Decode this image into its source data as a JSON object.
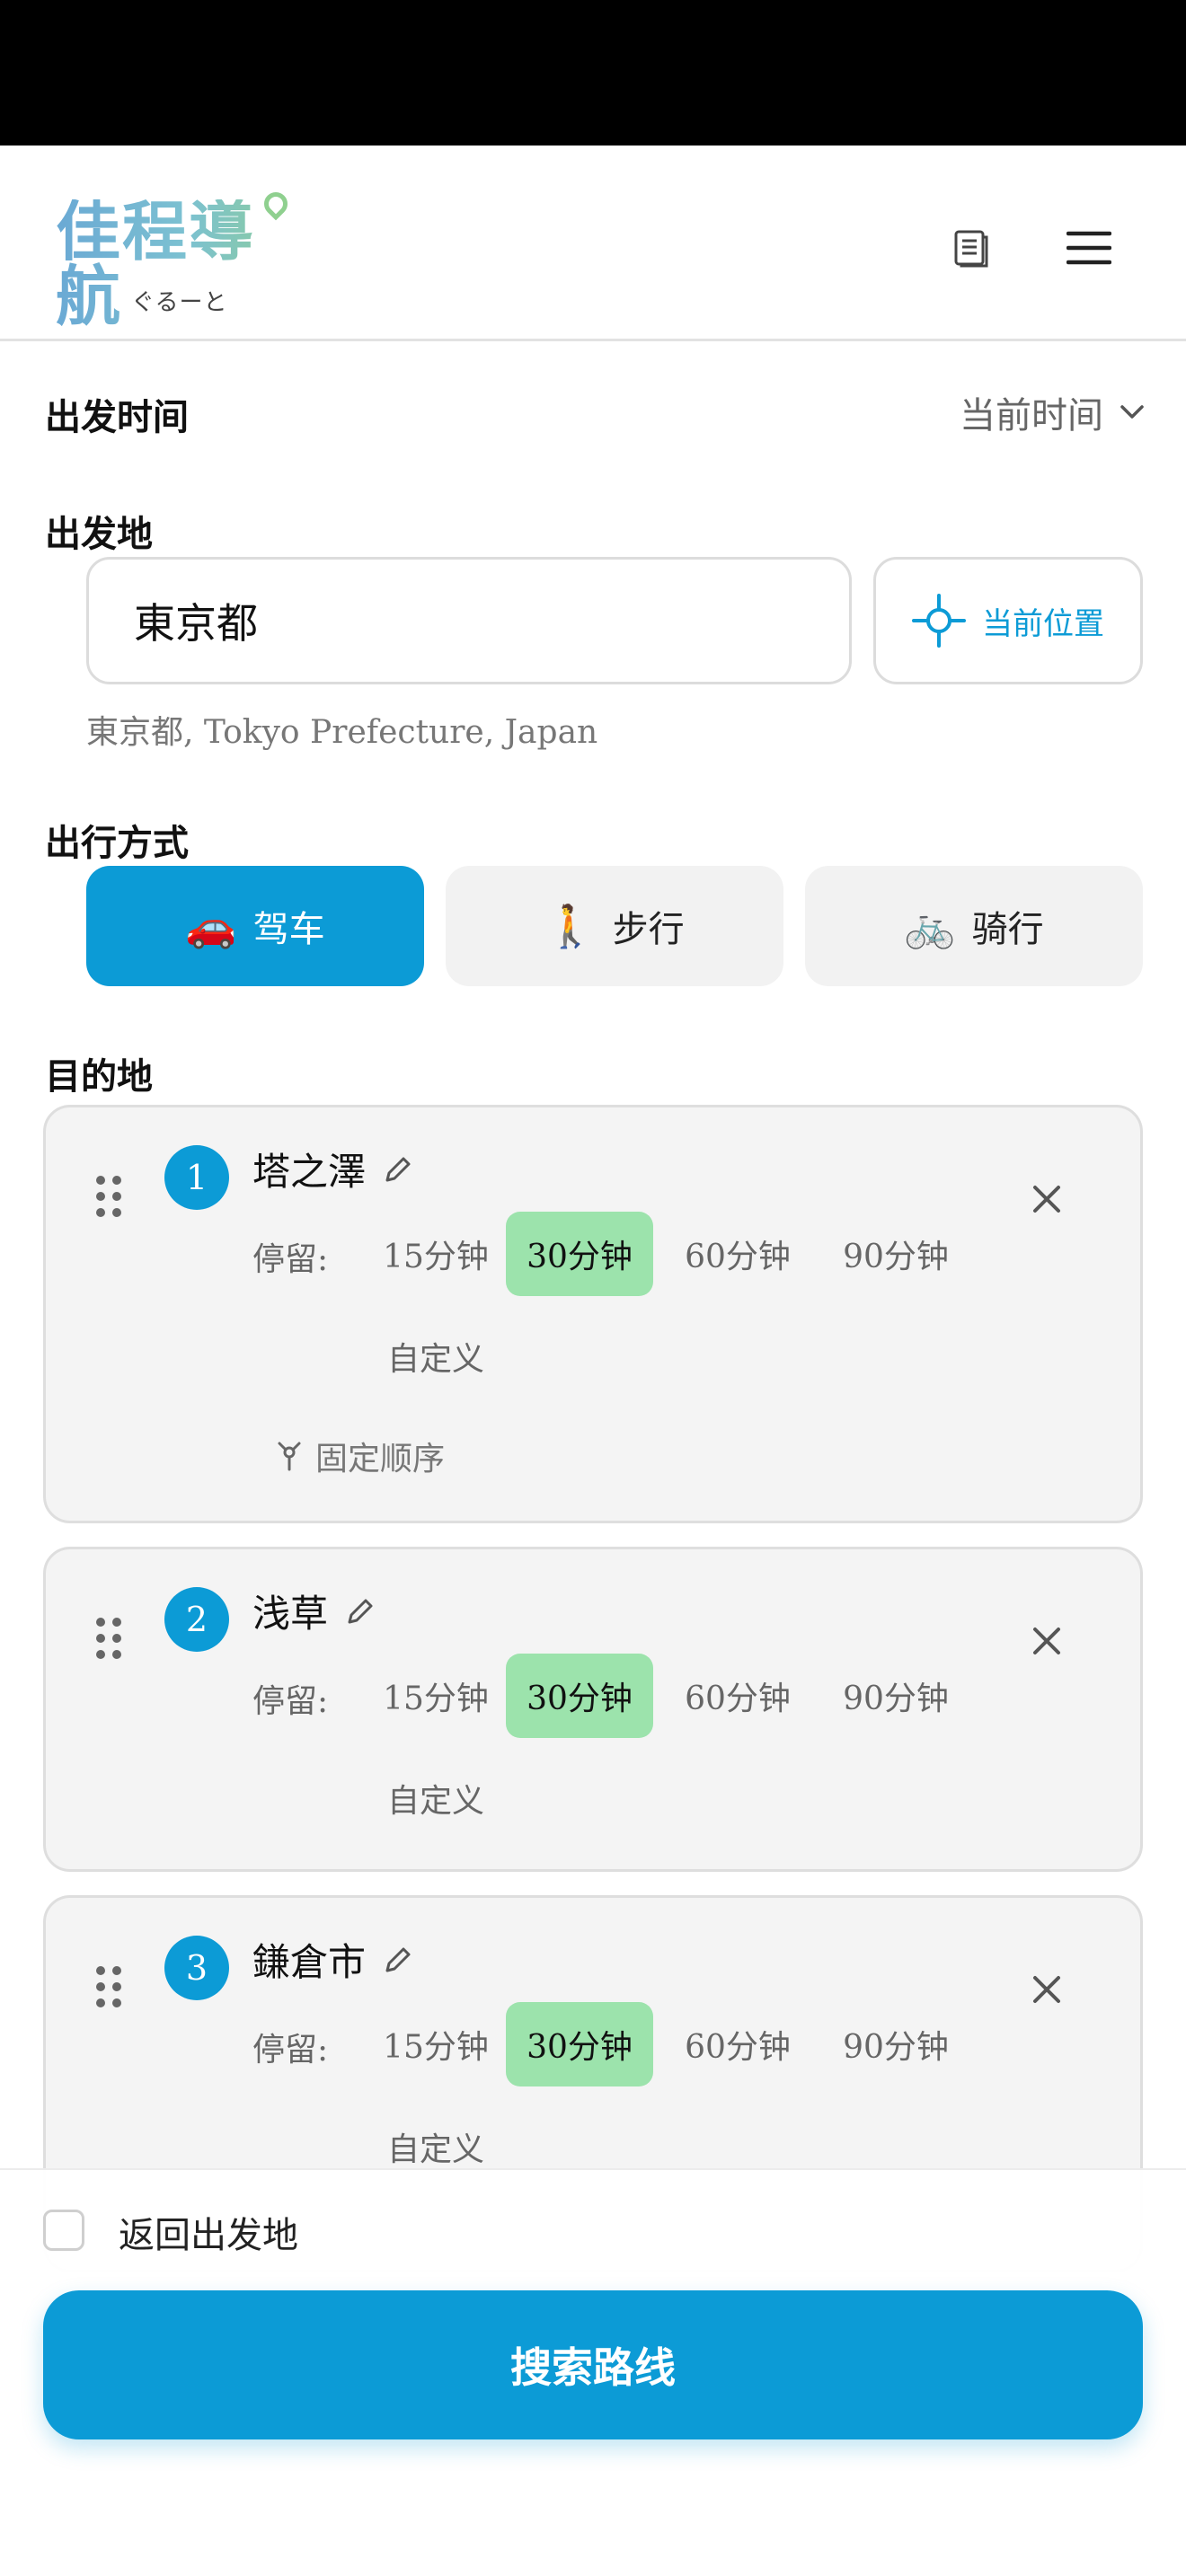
{
  "header": {
    "logo_text": "佳程導航",
    "logo_subtitle": "ぐるーと",
    "icons": [
      "document-icon",
      "hamburger-menu-icon"
    ]
  },
  "departure_time": {
    "label": "出发时间",
    "value": "当前时间"
  },
  "origin": {
    "label": "出发地",
    "value": "東京都",
    "current_location_label": "当前位置",
    "hint": "東京都, Tokyo Prefecture, Japan"
  },
  "travel_mode": {
    "label": "出行方式",
    "modes": [
      {
        "icon": "🚗",
        "label": "驾车",
        "selected": true
      },
      {
        "icon": "🚶",
        "label": "步行",
        "selected": false
      },
      {
        "icon": "🚲",
        "label": "骑行",
        "selected": false
      }
    ]
  },
  "destinations": {
    "label": "目的地",
    "stay_label": "停留:",
    "options": [
      "15分钟",
      "30分钟",
      "60分钟",
      "90分钟",
      "自定义"
    ],
    "fixed_order_label": "固定顺序",
    "items": [
      {
        "number": "1",
        "name": "塔之澤",
        "selected_option": "30分钟"
      },
      {
        "number": "2",
        "name": "浅草",
        "selected_option": "30分钟"
      },
      {
        "number": "3",
        "name": "鎌倉市",
        "selected_option": "30分钟"
      }
    ]
  },
  "footer": {
    "return_label": "返回出发地",
    "return_checked": false,
    "search_button": "搜索路线"
  },
  "colors": {
    "accent": "#0c9bd6",
    "selected_option": "#9ce3ac",
    "card_bg": "#f4f4f4"
  }
}
